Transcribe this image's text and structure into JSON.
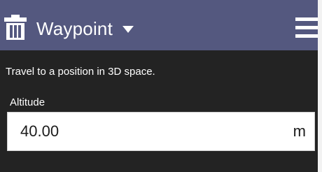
{
  "header": {
    "title": "Waypoint",
    "icons": {
      "delete": "trash-icon",
      "dropdown": "caret-down-icon",
      "menu": "hamburger-menu-icon"
    },
    "background_color": "#54587f"
  },
  "panel": {
    "description": "Travel to a position in 3D space.",
    "background_color": "#232323"
  },
  "altitude": {
    "label": "Altitude",
    "value": "40.00",
    "unit": "m"
  }
}
